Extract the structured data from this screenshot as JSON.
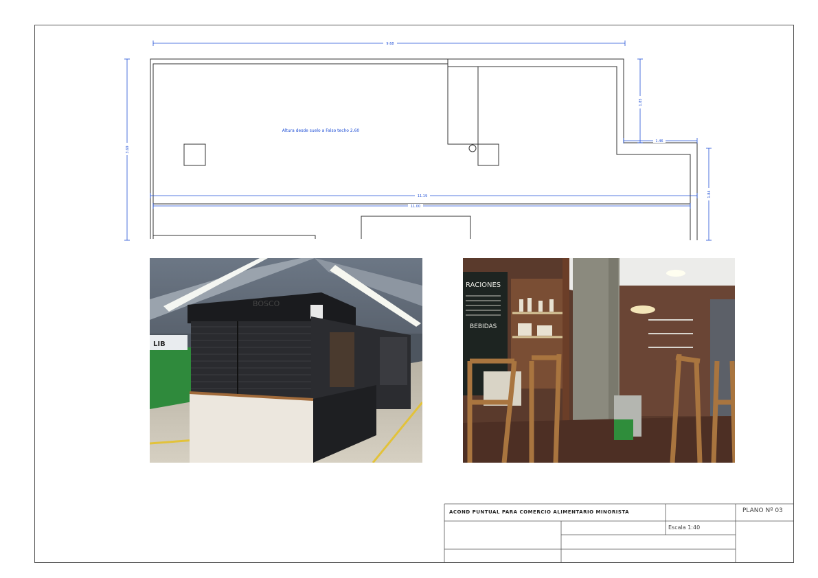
{
  "plan": {
    "annotation": "Altura desde suelo a Falso techo 2.60",
    "dims": {
      "top_width": "9.68",
      "left_height": "3.69",
      "right_upper": "1.85",
      "right_step": "1.46",
      "right_lower": "1.84",
      "inner_width_1": "11.19",
      "inner_width_2": "11.00"
    },
    "colors": {
      "dimension": "#1f4fd6",
      "wall": "#333333"
    }
  },
  "photos": {
    "left": {
      "sign_text": "BOSCO",
      "icon": "market-stall-exterior-photo"
    },
    "right": {
      "board_title": "RACIONES",
      "board_subtitle": "BEBIDAS",
      "icon": "bar-interior-photo"
    }
  },
  "title_block": {
    "project": "ACOND PUNTUAL PARA COMERCIO ALIMENTARIO MINORISTA",
    "plan_number": "PLANO Nº 03",
    "scale": "Escala 1:40"
  }
}
